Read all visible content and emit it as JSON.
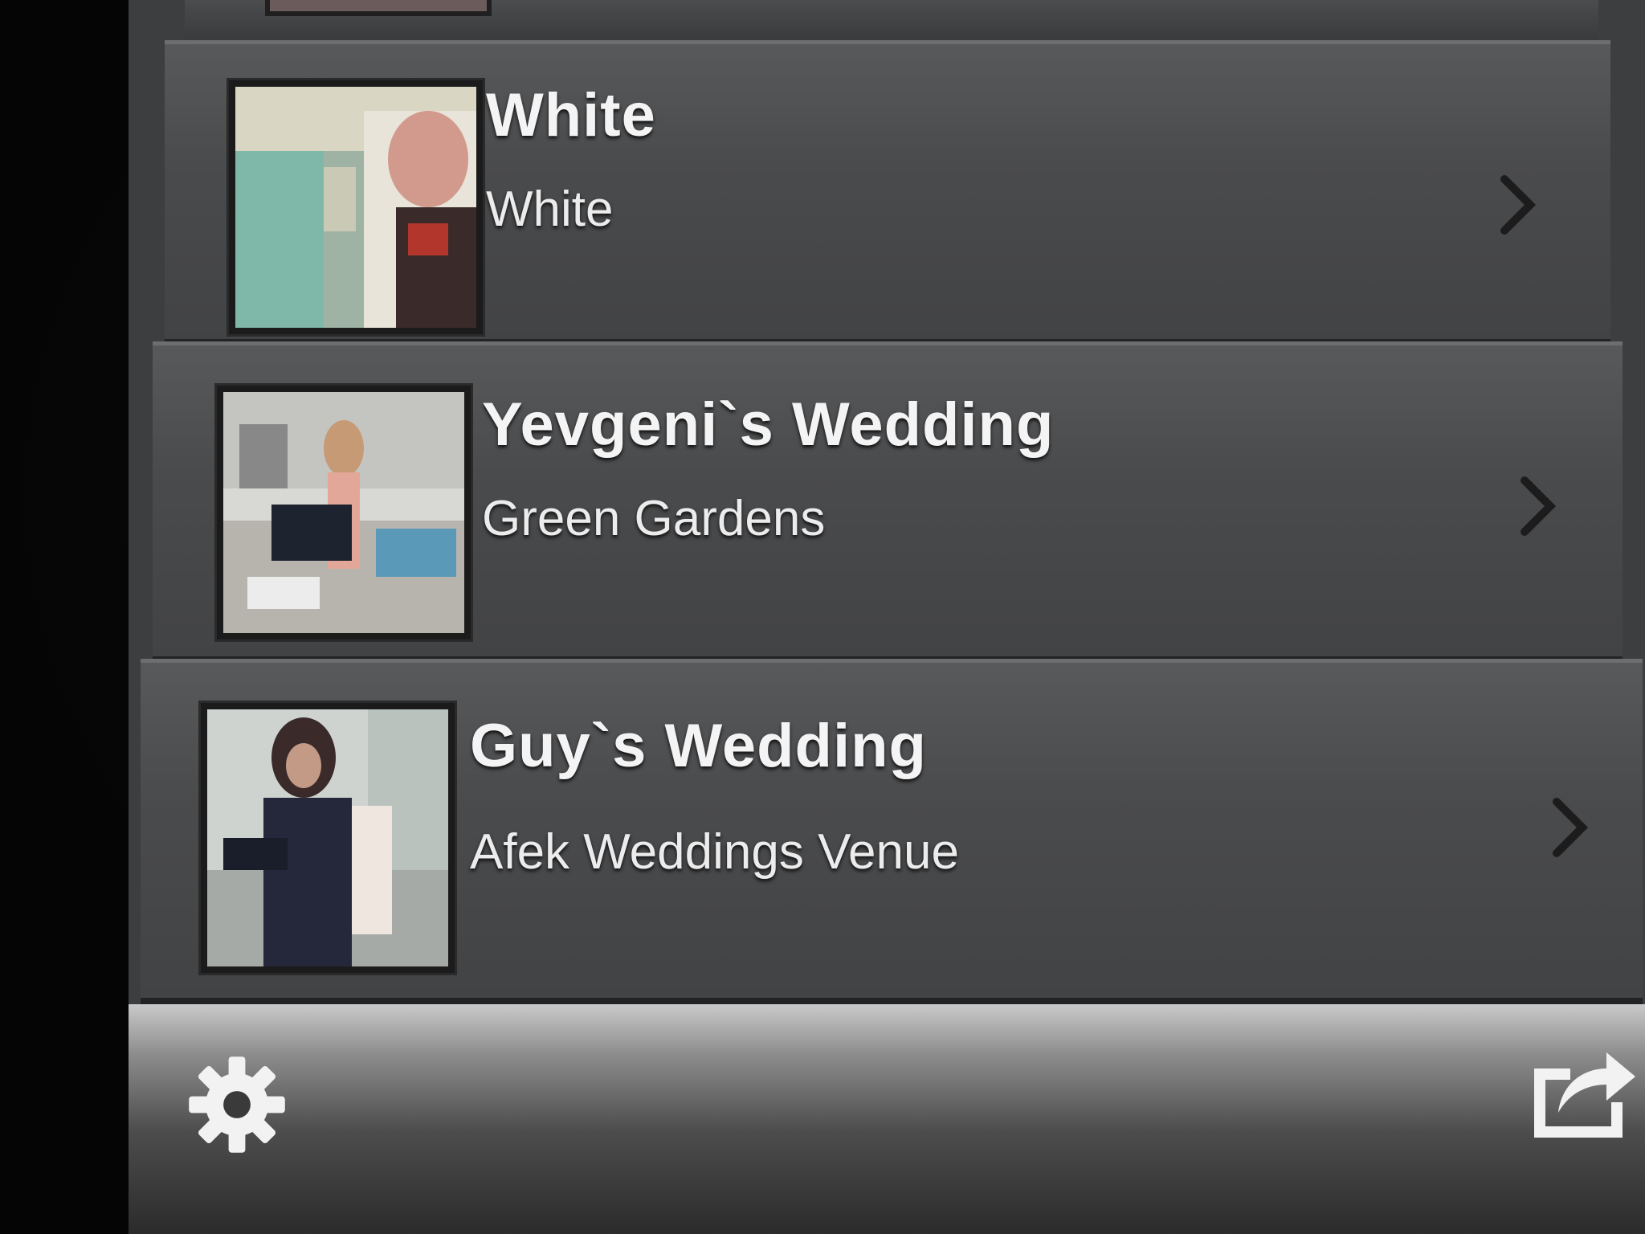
{
  "events": [
    {
      "title": "White",
      "subtitle": "White"
    },
    {
      "title": "Yevgeni`s Wedding",
      "subtitle": "Green Gardens"
    },
    {
      "title": "Guy`s Wedding",
      "subtitle": "Afek Weddings Venue"
    }
  ],
  "icons": {
    "watermark": "camera-pin-logo-icon",
    "row_disclosure": "chevron-right-icon",
    "settings": "gear-icon",
    "share": "share-icon"
  },
  "colors": {
    "row_background": "#4a4b4d",
    "text": "#f4f4f4",
    "toolbar_top": "#c9c9c9",
    "toolbar_bottom": "#2b2b2b"
  }
}
